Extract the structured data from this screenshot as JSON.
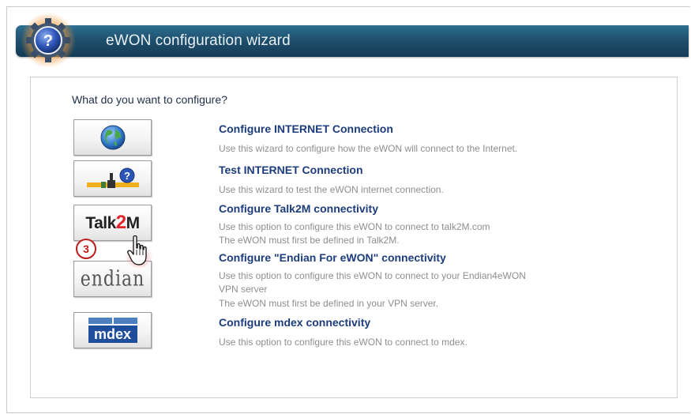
{
  "header": {
    "title": "eWON configuration wizard"
  },
  "question": "What do you want to configure?",
  "options": [
    {
      "title": "Configure INTERNET Connection",
      "desc": [
        "Use this wizard to configure how the eWON will connect to the Internet."
      ],
      "icon": "globe-icon"
    },
    {
      "title": "Test INTERNET Connection",
      "desc": [
        "Use this wizard to test the eWON internet connection."
      ],
      "icon": "network-test-icon"
    },
    {
      "title": "Configure Talk2M connectivity",
      "desc": [
        "Use this option to configure this eWON to connect to talk2M.com",
        "The eWON must first be defined in Talk2M."
      ],
      "logo": {
        "prefix": "Talk",
        "highlight": "2",
        "suffix": "M"
      }
    },
    {
      "title": "Configure \"Endian For eWON\" connectivity",
      "desc": [
        "Use this option to configure this eWON to connect to your Endian4eWON",
        "VPN server",
        "The eWON must first be defined in your VPN server."
      ],
      "logo": "endian"
    },
    {
      "title": "Configure mdex connectivity",
      "desc": [
        "Use this option to configure this eWON to connect to mdex."
      ],
      "logo": "mdex"
    }
  ],
  "step_badge": "3",
  "colors": {
    "header_bg": "#1f506e",
    "option_title": "#1c3c7c",
    "option_desc": "#8e8e8e",
    "badge": "#c01b1b",
    "talk2m_accent": "#e2232a",
    "mdex_blue": "#1f4e9c"
  },
  "icons": [
    "help-gear-icon",
    "globe-icon",
    "network-test-icon",
    "hand-pointer-icon"
  ]
}
